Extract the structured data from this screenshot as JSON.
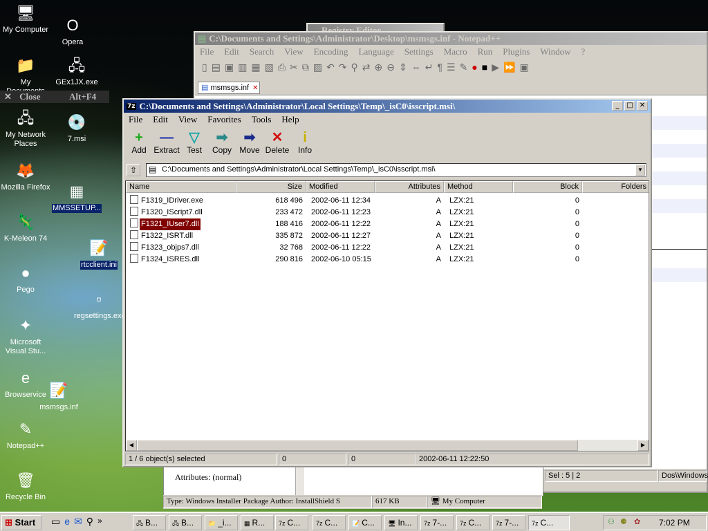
{
  "desktop": {
    "icons": [
      {
        "label": "My Computer",
        "glyph": "🖥"
      },
      {
        "label": "Opera",
        "glyph": "O"
      },
      {
        "label": "My Documents",
        "glyph": "📁"
      },
      {
        "label": "GEx1JX.exe",
        "glyph": "🖧"
      },
      {
        "label": "My Network Places",
        "glyph": "🖧"
      },
      {
        "label": "7.msi",
        "glyph": "💿"
      },
      {
        "label": "Mozilla Firefox",
        "glyph": "🦊"
      },
      {
        "label": "MMSSETUP...",
        "glyph": "▦"
      },
      {
        "label": "K-Meleon 74",
        "glyph": "🦎"
      },
      {
        "label": "rtcclient.ini",
        "glyph": "📝"
      },
      {
        "label": "Pego",
        "glyph": "●"
      },
      {
        "label": "regsettings.exe",
        "glyph": "▫"
      },
      {
        "label": "Microsoft Visual Stu...",
        "glyph": "✦"
      },
      {
        "label": "Browservice",
        "glyph": "e"
      },
      {
        "label": "msmsgs.inf",
        "glyph": "📝"
      },
      {
        "label": "Notepad++",
        "glyph": "✎"
      },
      {
        "label": "Recycle Bin",
        "glyph": "🗑"
      }
    ],
    "context_menu": {
      "label": "Close",
      "shortcut": "Alt+F4"
    }
  },
  "registry_editor": {
    "title": "Registry Editor"
  },
  "notepadpp": {
    "title": "C:\\Documents and Settings\\Administrator\\Desktop\\msmsgs.inf - Notepad++",
    "menu": [
      "File",
      "Edit",
      "Search",
      "View",
      "Encoding",
      "Language",
      "Settings",
      "Macro",
      "Run",
      "Plugins",
      "Window",
      "?"
    ],
    "tab": "msmsgs.inf",
    "status_sel": "Sel : 5 | 2",
    "status_eol": "Dos\\Windows"
  },
  "properties_pane": {
    "attributes": "Attributes: (normal)",
    "status_type": "Type: Windows Installer Package Author: InstallShield S",
    "status_size": "617 KB",
    "status_location": "My Computer"
  },
  "sevenzip": {
    "title": "C:\\Documents and Settings\\Administrator\\Local Settings\\Temp\\_isC0\\isscript.msi\\",
    "menu": [
      "File",
      "Edit",
      "View",
      "Favorites",
      "Tools",
      "Help"
    ],
    "toolbar": [
      {
        "label": "Add",
        "glyph": "+",
        "color": "#1aa81a"
      },
      {
        "label": "Extract",
        "glyph": "—",
        "color": "#1a2ea8"
      },
      {
        "label": "Test",
        "glyph": "▽",
        "color": "#1aa8a8"
      },
      {
        "label": "Copy",
        "glyph": "➡",
        "color": "#2a8a8a"
      },
      {
        "label": "Move",
        "glyph": "➡",
        "color": "#1a2a8a"
      },
      {
        "label": "Delete",
        "glyph": "✕",
        "color": "#d01010"
      },
      {
        "label": "Info",
        "glyph": "i",
        "color": "#c8b000"
      }
    ],
    "address": "C:\\Documents and Settings\\Administrator\\Local Settings\\Temp\\_isC0\\isscript.msi\\",
    "columns": [
      "Name",
      "Size",
      "Modified",
      "Attributes",
      "Method",
      "Block",
      "Folders"
    ],
    "files": [
      {
        "name": "F1319_IDriver.exe",
        "size": "618 496",
        "modified": "2002-06-11 12:34",
        "attr": "A",
        "method": "LZX:21",
        "block": "0",
        "selected": false
      },
      {
        "name": "F1320_IScript7.dll",
        "size": "233 472",
        "modified": "2002-06-11 12:23",
        "attr": "A",
        "method": "LZX:21",
        "block": "0",
        "selected": false
      },
      {
        "name": "F1321_IUser7.dll",
        "size": "188 416",
        "modified": "2002-06-11 12:22",
        "attr": "A",
        "method": "LZX:21",
        "block": "0",
        "selected": true
      },
      {
        "name": "F1322_ISRT.dll",
        "size": "335 872",
        "modified": "2002-06-11 12:27",
        "attr": "A",
        "method": "LZX:21",
        "block": "0",
        "selected": false
      },
      {
        "name": "F1323_objps7.dll",
        "size": "32 768",
        "modified": "2002-06-11 12:22",
        "attr": "A",
        "method": "LZX:21",
        "block": "0",
        "selected": false
      },
      {
        "name": "F1324_ISRES.dll",
        "size": "290 816",
        "modified": "2002-06-10 05:15",
        "attr": "A",
        "method": "LZX:21",
        "block": "0",
        "selected": false
      }
    ],
    "status": {
      "selected": "1 / 6 object(s) selected",
      "size": "0",
      "packed": "0",
      "modified": "2002-06-11 12:22:50"
    }
  },
  "taskbar": {
    "start": "Start",
    "buttons": [
      "B...",
      "B...",
      "_i...",
      "R...",
      "C...",
      "C...",
      "C...",
      "In...",
      "7-...",
      "C...",
      "7-...",
      "C..."
    ],
    "clock": "7:02 PM"
  }
}
